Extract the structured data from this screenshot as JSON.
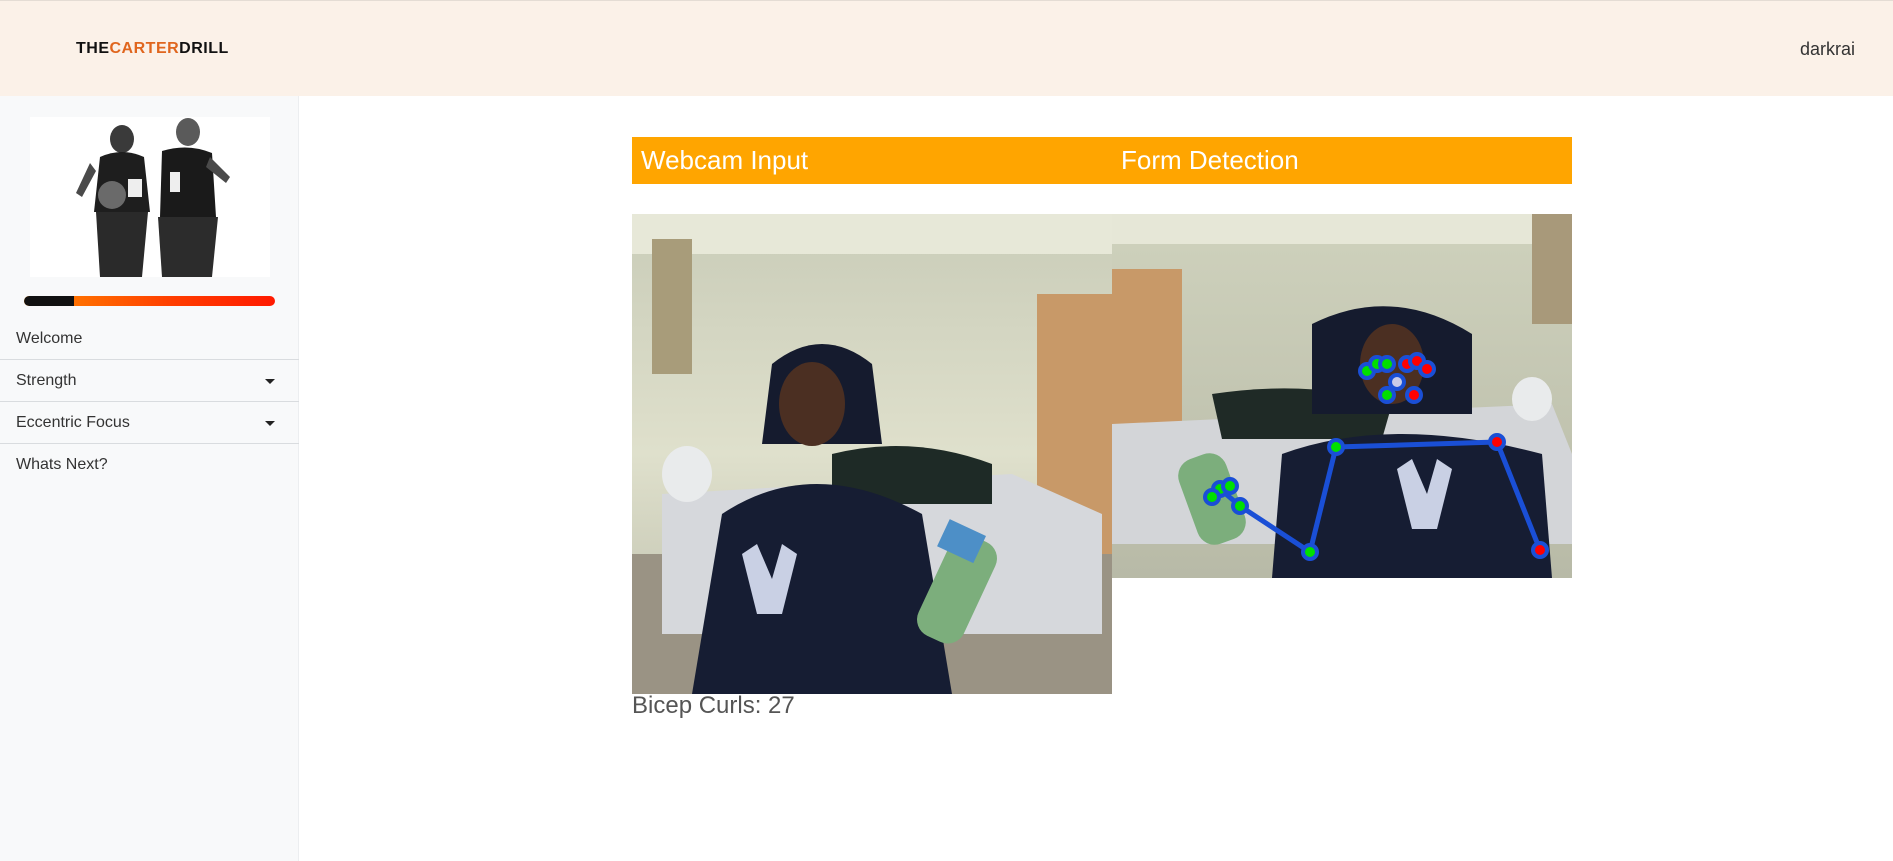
{
  "header": {
    "brand_part1": "THE",
    "brand_part2": "CARTER",
    "brand_part3": "DRILL",
    "username": "darkrai"
  },
  "sidebar": {
    "progress": 0.2,
    "items": [
      {
        "label": "Welcome",
        "has_dropdown": false
      },
      {
        "label": "Strength",
        "has_dropdown": true
      },
      {
        "label": "Eccentric Focus",
        "has_dropdown": true
      },
      {
        "label": "Whats Next?",
        "has_dropdown": false
      }
    ]
  },
  "main": {
    "webcam_title": "Webcam Input",
    "form_title": "Form Detection",
    "counter_text": "Bicep Curls: 27"
  },
  "colors": {
    "header_bg": "#fbf1e8",
    "accent": "#ffa500",
    "brand_orange": "#e0661e",
    "keypoint_left": "#00e000",
    "keypoint_right": "#ff0000",
    "skeleton": "#1a4fd6"
  }
}
